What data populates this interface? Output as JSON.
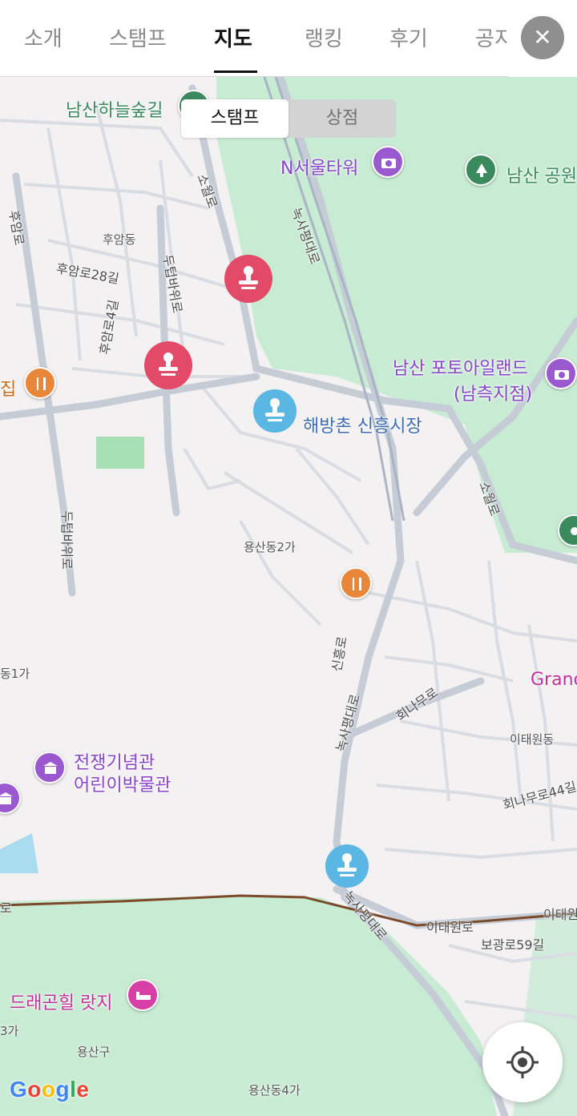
{
  "tabs": [
    {
      "label": "소개",
      "active": false
    },
    {
      "label": "스탬프",
      "active": false
    },
    {
      "label": "지도",
      "active": true
    },
    {
      "label": "랭킹",
      "active": false
    },
    {
      "label": "후기",
      "active": false
    },
    {
      "label": "공지",
      "active": false
    }
  ],
  "close_icon": "close-icon",
  "toggle": {
    "stamp": "스탬프",
    "shop": "상점",
    "selected": "스탬프"
  },
  "places": {
    "namsan_sky_trail": "남산하늘숲길",
    "n_seoul_tower": "N서울타워",
    "namsan_park": "남산 공원",
    "photo_island_1": "남산 포토아일랜드",
    "photo_island_2": "(남측지점)",
    "haebangchon_market": "해방촌 신흥시장",
    "restaurant_partial": "집",
    "war_memorial_1": "전쟁기념관",
    "war_memorial_2": "어린이박물관",
    "grand": "Grand",
    "dragon_hill": "드래곤힐 랏지"
  },
  "roads": {
    "huamro": "후암로",
    "huamdong": "후암동",
    "huamro28": "후암로28길",
    "huamro4": "후암로4길",
    "dutbawiro1": "두텁바위로",
    "dutbawiro2": "두텁바위로",
    "sowolro1": "소월로",
    "sowolro2": "소월로",
    "noksapyeong1": "녹사평대로",
    "noksapyeong2": "녹사평대로",
    "noksapyeong3": "녹사평대로",
    "yongsan2ga": "용산동2가",
    "dong1ga": "동1가",
    "sinheungro": "신흥로",
    "heenamuro": "회나무로",
    "itaewondong": "이태원동",
    "heenamuro44": "회나무로44길",
    "itaewonro": "이태원로",
    "itaewon_partial": "이태원",
    "bogwangro59": "보광로59길",
    "ro_partial": "로",
    "ga3": "3가",
    "yongsangu": "용산구",
    "yongsan4ga": "용산동4가"
  },
  "google": "Google",
  "locate_icon": "crosshair-icon",
  "colors": {
    "stamp_red": "#e24a67",
    "stamp_blue": "#5ab6e2",
    "park": "#c8ebd3",
    "poi_purple": "#9b59d0",
    "poi_orange": "#e8863a"
  }
}
